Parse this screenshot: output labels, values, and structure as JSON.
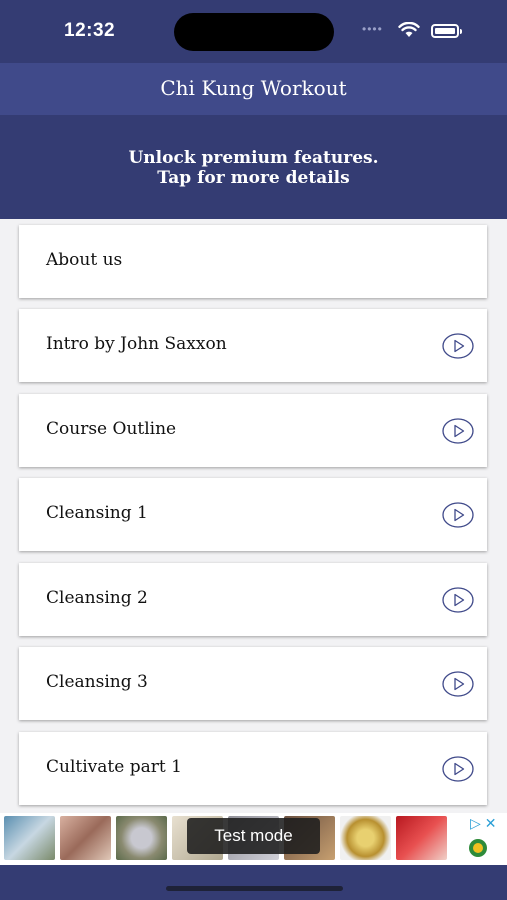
{
  "status_bar": {
    "time": "12:32"
  },
  "header": {
    "title": "Chi Kung Workout"
  },
  "premium_banner": {
    "line1": "Unlock premium features.",
    "line2": "Tap for more details"
  },
  "menu": {
    "items": [
      {
        "label": "About us",
        "has_play": false
      },
      {
        "label": "Intro by John Saxxon",
        "has_play": true
      },
      {
        "label": "Course Outline",
        "has_play": true
      },
      {
        "label": "Cleansing 1",
        "has_play": true
      },
      {
        "label": "Cleansing 2",
        "has_play": true
      },
      {
        "label": "Cleansing 3",
        "has_play": true
      },
      {
        "label": "Cultivate part 1",
        "has_play": true
      }
    ]
  },
  "ad_banner": {
    "test_mode_label": "Test mode"
  },
  "colors": {
    "primary_dark": "#343c73",
    "primary": "#404a8a",
    "play_icon": "#404a8a"
  }
}
